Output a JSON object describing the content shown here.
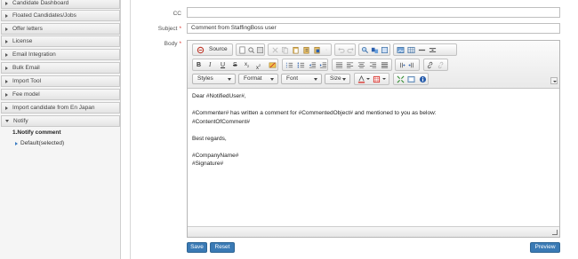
{
  "sidebar": {
    "items": [
      {
        "label": "Candidate Dashboard",
        "expanded": false
      },
      {
        "label": "Floated Candidates/Jobs",
        "expanded": false
      },
      {
        "label": "Offer letters",
        "expanded": false
      },
      {
        "label": "License",
        "expanded": false
      },
      {
        "label": "Email Integration",
        "expanded": false
      },
      {
        "label": "Bulk Email",
        "expanded": false
      },
      {
        "label": "Import Tool",
        "expanded": false
      },
      {
        "label": "Fee model",
        "expanded": false
      },
      {
        "label": "Import candidate from En Japan",
        "expanded": false
      },
      {
        "label": "Notify",
        "expanded": true
      }
    ],
    "sub_title": "1.Notify comment",
    "sub_item": "Default(selected)"
  },
  "form": {
    "cc_label": "CC",
    "cc_value": "",
    "subject_label": "Subject",
    "subject_value": "Comment from StaffingBoss user",
    "body_label": "Body",
    "required_mark": "*"
  },
  "editor": {
    "source_label": "Source",
    "combos": [
      "Styles",
      "Format",
      "Font",
      "Size"
    ],
    "content": [
      "Dear #NotifiedUser#,",
      "",
      "#Commenter# has written a comment for #CommentedObject# and mentioned to you as below:",
      "#ContentOfComment#",
      "",
      "Best regards,",
      "",
      "#CompanyName#",
      "#Signature#"
    ]
  },
  "buttons": {
    "save": "Save",
    "reset": "Reset",
    "preview": "Preview"
  },
  "colors": {
    "accent": "#3a7ab5",
    "required": "#d9312b"
  }
}
